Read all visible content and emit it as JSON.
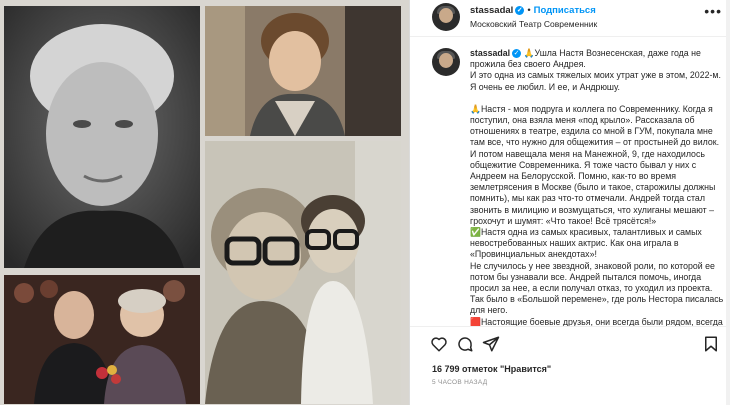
{
  "post": {
    "username": "stassadal",
    "follow_label": "Подписаться",
    "location": "Московский Театр Современник",
    "more_glyph": "•••"
  },
  "caption": {
    "username": "stassadal",
    "paragraphs": [
      "🙏Ушла Настя Вознесенская, даже года не прожила без своего Андрея.",
      "И это одна из самых тяжелых моих утрат уже в этом, 2022-м.",
      "Я очень ее любил. И ее, и Андрюшу.",
      "",
      "🙏Настя - моя подруга и коллега по Современнику. Когда я поступил, она взяла меня «под крыло». Рассказала об отношениях в театре, ездила со мной в ГУМ, покупала мне там все, что нужно для общежития – от простыней до вилок.",
      "И потом навещала меня на Манежной, 9, где находилось общежитие Современника. Я тоже часто бывал у них с Андреем на Белорусской. Помню, как-то во время землетрясения в Москве (было и такое, старожилы должны помнить), мы как раз что-то отмечали. Андрей тогда стал звонить в милицию и возмущаться, что хулиганы мешают – грохочут и шумят: «Что такое! Всё трясётся!»",
      "✅Настя одна из самых красивых, талантливых и самых невостребованных наших актрис. Как она играла в «Провинциальных анекдотах»!",
      "Не случилось у нее звездной, знаковой роли, по которой ее потом бы узнавали все. Андрей пытался помочь, иногда просил за нее, а если получал отказ, то уходил из проекта. Так было в «Большой перемене», где роль Нестора писалась для него.",
      "🟥Настоящие боевые друзья, они всегда были рядом, всегда"
    ]
  },
  "actions": {
    "icons": [
      "heart-icon",
      "comment-icon",
      "share-icon",
      "bookmark-icon"
    ]
  },
  "likes_text": "16 799 отметок \"Нравится\"",
  "time_text": "5 ЧАСОВ НАЗАД",
  "colors": {
    "link_blue": "#0095f6",
    "text": "#262626",
    "muted": "#8e8e8e"
  }
}
